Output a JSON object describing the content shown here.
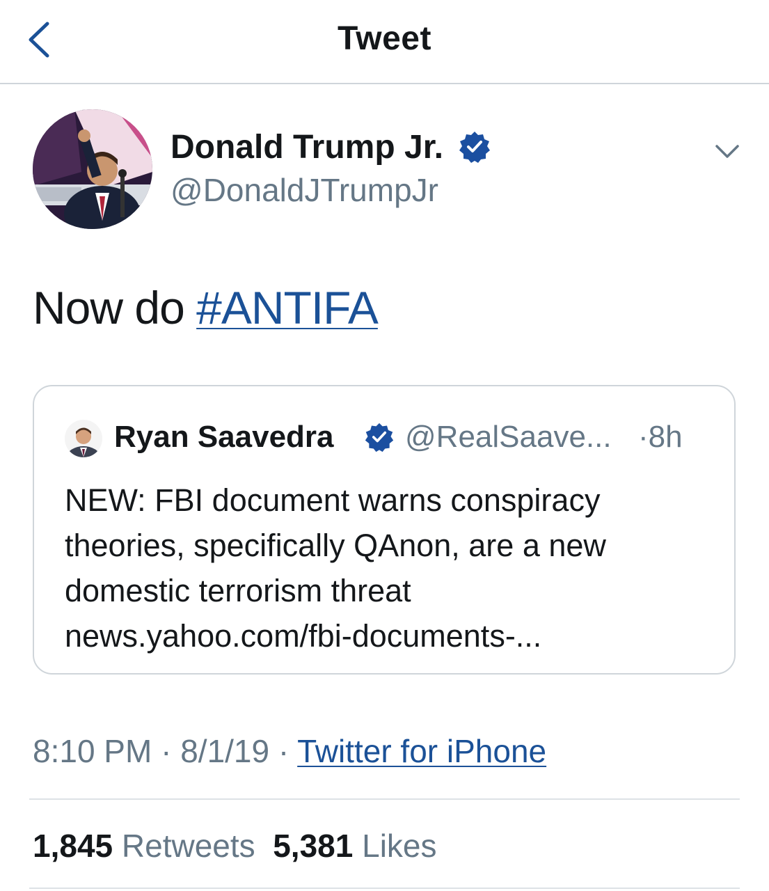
{
  "header": {
    "title": "Tweet"
  },
  "author": {
    "name": "Donald Trump Jr.",
    "handle": "@DonaldJTrumpJr",
    "verified": true
  },
  "tweet": {
    "text_prefix": "Now do ",
    "hashtag": "#ANTIFA"
  },
  "quoted_tweet": {
    "name": "Ryan Saavedra",
    "handle": "@RealSaave...",
    "time": "·8h",
    "verified": true,
    "lines": [
      "NEW: FBI document warns conspiracy",
      "theories, specifically QAnon, are a new",
      "domestic terrorism threat",
      "news.yahoo.com/fbi-documents-..."
    ]
  },
  "meta": {
    "time": "8:10 PM",
    "sep1": " · ",
    "date": "8/1/19",
    "sep2": " · ",
    "source": "Twitter for iPhone"
  },
  "stats": {
    "retweets_count": "1,845",
    "retweets_label": "Retweets",
    "likes_count": "5,381",
    "likes_label": "Likes"
  },
  "colors": {
    "link": "#1b5197",
    "secondary_text": "#657786",
    "verified_badge": "#1b4fa0"
  },
  "icons": {
    "back": "chevron-left-icon",
    "menu": "chevron-down-icon",
    "verified": "verified-badge-icon"
  }
}
